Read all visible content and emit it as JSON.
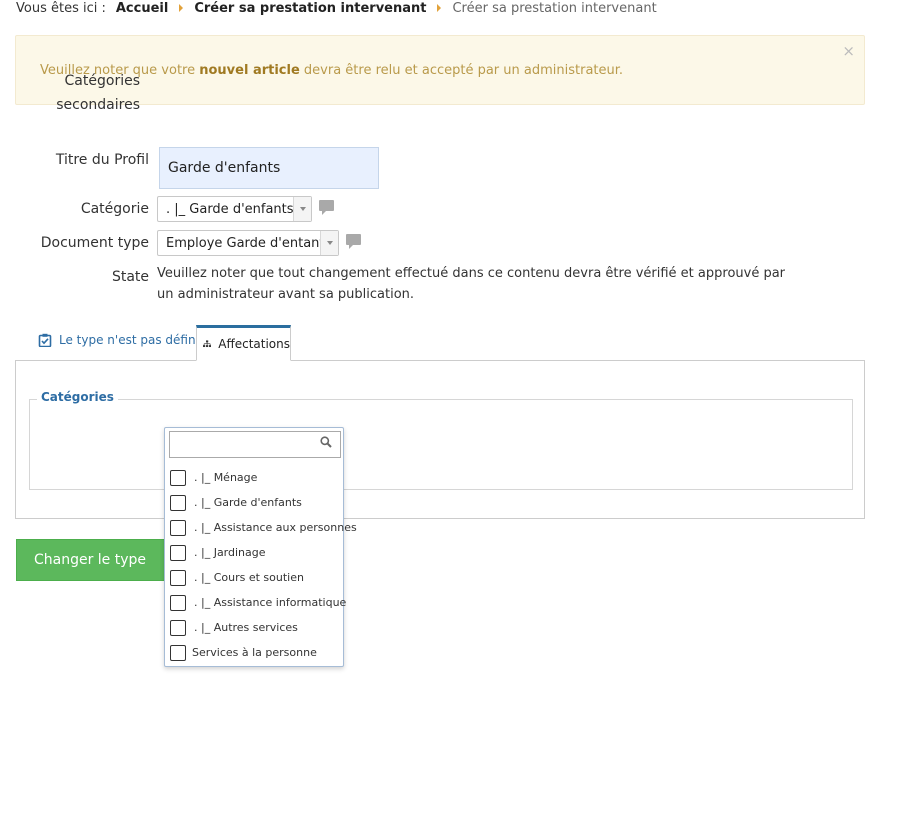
{
  "breadcrumb": {
    "label": "Vous êtes ici :",
    "items": [
      "Accueil",
      "Créer sa prestation intervenant"
    ],
    "current": "Créer sa prestation intervenant"
  },
  "alert": {
    "prefix": "Veuillez noter que votre ",
    "highlight": "nouvel article",
    "suffix": " devra être relu et accepté par un administrateur.",
    "close": "×"
  },
  "form": {
    "title_label": "Titre du Profil",
    "title_value": "Garde d'enfants",
    "category_label": "Catégorie",
    "category_value": ". |_ Garde d'enfants",
    "doctype_label": "Document type",
    "doctype_value": "Employe Garde d'entant",
    "state_label": "State",
    "state_text": "Veuillez noter que tout changement effectué dans ce contenu devra être vérifié et approuvé par un administrateur avant sa publication."
  },
  "tabs": [
    {
      "label": "Le type n'est pas défini",
      "icon": "checklist-icon"
    },
    {
      "label": "Affectations",
      "icon": "sitemap-icon"
    }
  ],
  "panel": {
    "legend": "Catégories",
    "secondary_label_line1": "Catégories",
    "secondary_label_line2": "secondaires"
  },
  "dropdown": {
    "search_value": "",
    "items": [
      ". |_ Ménage",
      ". |_ Garde d'enfants",
      ". |_ Assistance aux personnes",
      ". |_ Jardinage",
      ". |_ Cours et soutien",
      ". |_ Assistance informatique",
      ". |_ Autres services",
      "Services à la personne"
    ]
  },
  "buttons": {
    "change_type": "Changer le type"
  },
  "colors": {
    "accent": "#2e6da4",
    "success": "#5cb85c",
    "alert_bg": "#fcf8e8",
    "alert_text": "#b99a4b"
  }
}
